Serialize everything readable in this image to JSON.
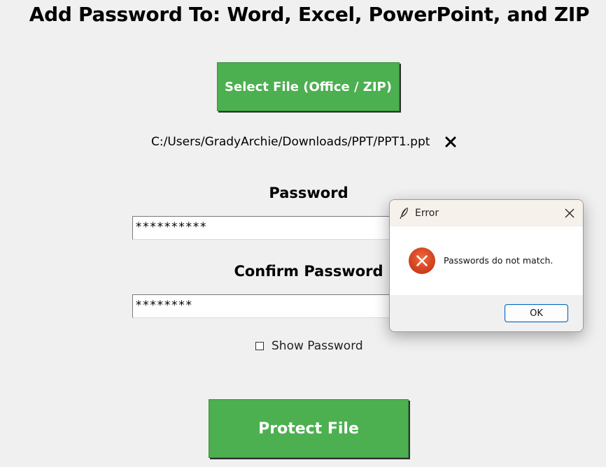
{
  "app": {
    "title": "Add Password To: Word, Excel, PowerPoint, and ZIP"
  },
  "select_file": {
    "label": "Select File (Office / ZIP)"
  },
  "file": {
    "path": "C:/Users/GradyArchie/Downloads/PPT/PPT1.ppt",
    "clear_icon": "close-x-icon"
  },
  "password": {
    "label": "Password",
    "value": "**********"
  },
  "confirm_password": {
    "label": "Confirm Password",
    "value": "********"
  },
  "show_password": {
    "label": "Show Password",
    "checked": false
  },
  "protect": {
    "label": "Protect File"
  },
  "error_dialog": {
    "title": "Error",
    "message": "Passwords do not match.",
    "ok_label": "OK",
    "icon": "error-x-circle-icon",
    "title_icon": "feather-icon"
  },
  "colors": {
    "button_green": "#4caf50",
    "background": "#f0f0f0",
    "error_red": "#d9461e",
    "ok_border": "#0067c0"
  }
}
